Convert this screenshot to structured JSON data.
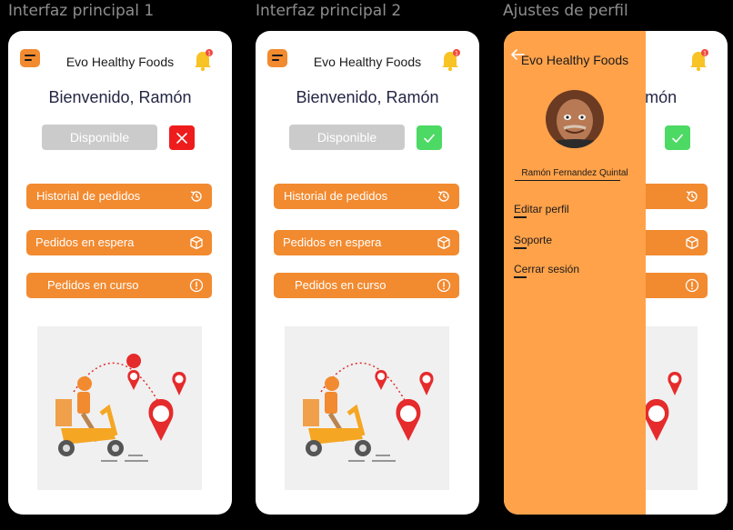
{
  "frames": [
    {
      "title": "Interfaz principal 1",
      "brand": "Evo Healthy Foods",
      "welcome": "Bienvenido, Ramón",
      "available_label": "Disponible",
      "status": "off"
    },
    {
      "title": "Interfaz principal 2",
      "brand": "Evo Healthy Foods",
      "welcome": "Bienvenido, Ramón",
      "available_label": "Disponible",
      "status": "on"
    },
    {
      "title": "Ajustes de perfil",
      "brand": "Evo Healthy Foods",
      "welcome": "Bienvenido, Ramón",
      "status": "on"
    }
  ],
  "actions": [
    {
      "label": "Historial de pedidos",
      "icon": "history-icon"
    },
    {
      "label": "Pedidos en espera",
      "icon": "box-icon"
    },
    {
      "label": "Pedidos en curso",
      "icon": "alert-circle-icon"
    }
  ],
  "drawer": {
    "brand": "Evo Healthy Foods",
    "user_name": "Ramón Fernandez Quintal",
    "links": [
      "Editar perfil",
      "Soporte",
      "Cerrar sesión"
    ]
  },
  "colors": {
    "accent": "#f28a2f",
    "drawer": "#ffa24a",
    "off": "#ee1c1c",
    "on": "#4cd964",
    "available_bg": "#cbcbcb"
  }
}
